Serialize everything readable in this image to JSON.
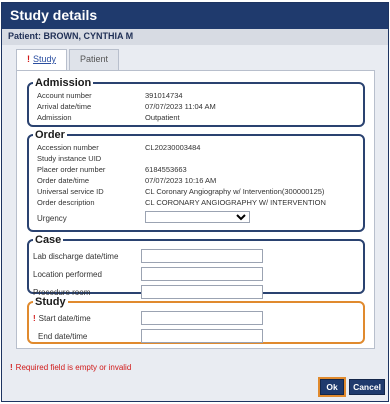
{
  "dialog": {
    "title": "Study details",
    "patient": "Patient: BROWN, CYNTHIA M"
  },
  "tabs": [
    {
      "label": "Study",
      "required": "!",
      "active": true
    },
    {
      "label": "Patient",
      "active": false
    }
  ],
  "admission": {
    "legend": "Admission",
    "rows": [
      {
        "label": "Account number",
        "value": "391014734"
      },
      {
        "label": "Arrival date/time",
        "value": "07/07/2023 11:04 AM"
      },
      {
        "label": "Admission",
        "value": "Outpatient"
      }
    ]
  },
  "order": {
    "legend": "Order",
    "rows": [
      {
        "label": "Accession number",
        "value": "CL20230003484"
      },
      {
        "label": "Study instance UID",
        "value": ""
      },
      {
        "label": "Placer order number",
        "value": "6184553663"
      },
      {
        "label": "Order date/time",
        "value": "07/07/2023 10:16 AM"
      },
      {
        "label": "Universal service ID",
        "value": "CL Coronary Angiography w/ Intervention(300000125)"
      },
      {
        "label": "Order description",
        "value": "CL CORONARY ANGIOGRAPHY W/ INTERVENTION"
      }
    ],
    "urgency_label": "Urgency",
    "urgency_value": ""
  },
  "case": {
    "legend": "Case",
    "fields": [
      {
        "label": "Lab discharge date/time",
        "value": ""
      },
      {
        "label": "Location performed",
        "value": ""
      },
      {
        "label": "Procedure room",
        "value": ""
      }
    ]
  },
  "study": {
    "legend": "Study",
    "fields": [
      {
        "label": "Start date/time",
        "value": "",
        "required": "!"
      },
      {
        "label": "End date/time",
        "value": ""
      }
    ]
  },
  "footer": {
    "required_mark": "!",
    "message": "Required field is empty or invalid",
    "ok_label": "Ok",
    "cancel_label": "Cancel"
  }
}
